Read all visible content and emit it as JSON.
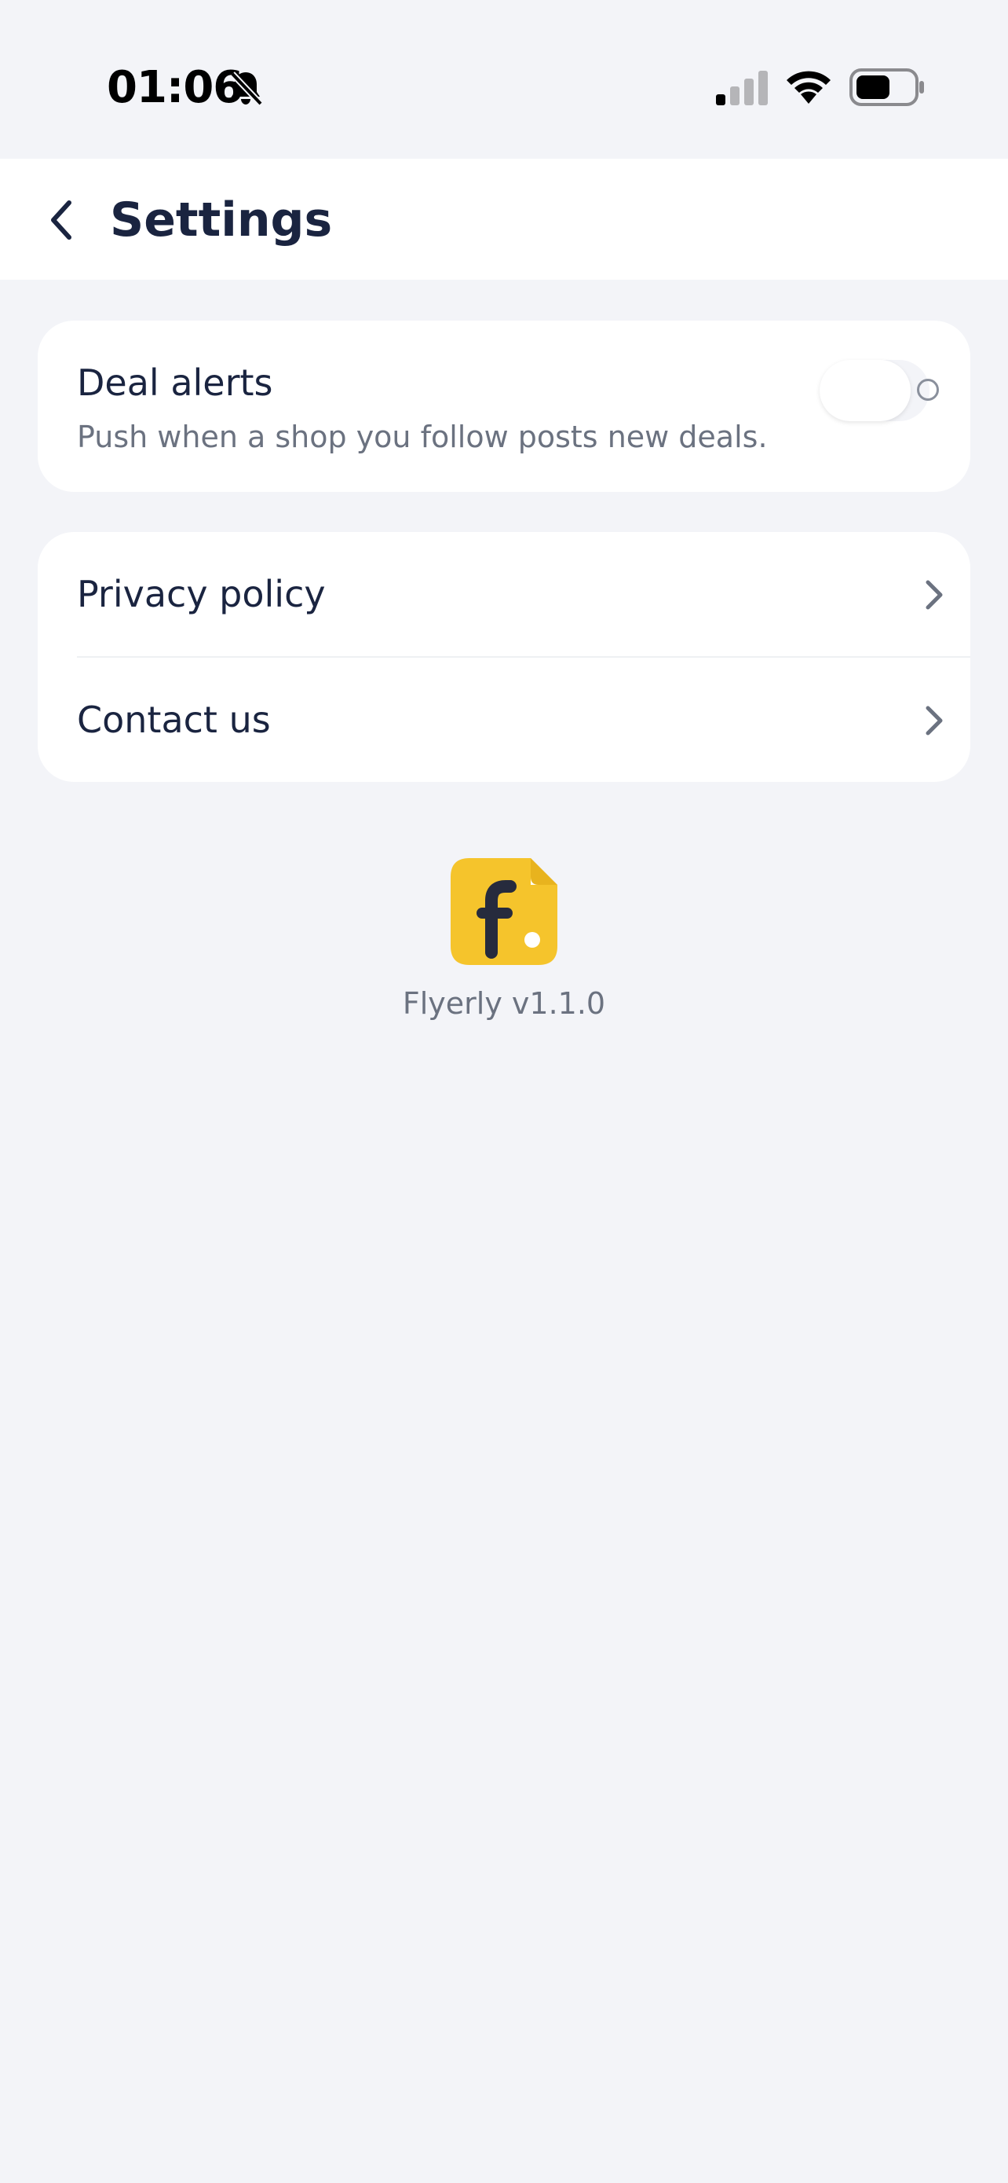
{
  "status_bar": {
    "time": "01:06",
    "icons": [
      "bell-off-icon",
      "signal-icon",
      "wifi-icon",
      "battery-icon"
    ]
  },
  "header": {
    "title": "Settings",
    "back_icon": "chevron-left-icon"
  },
  "deal_alerts": {
    "title": "Deal alerts",
    "description": "Push when a shop you follow posts new deals.",
    "toggle_state": "off"
  },
  "links": [
    {
      "label": "Privacy policy",
      "icon": "chevron-right-icon"
    },
    {
      "label": "Contact us",
      "icon": "chevron-right-icon"
    }
  ],
  "app": {
    "logo_icon": "flyerly-logo",
    "version": "Flyerly v1.1.0"
  },
  "colors": {
    "background": "#f3f4f8",
    "surface": "#ffffff",
    "text_primary": "#1a2440",
    "text_secondary": "#6b7280",
    "brand_yellow": "#f5c42c"
  }
}
